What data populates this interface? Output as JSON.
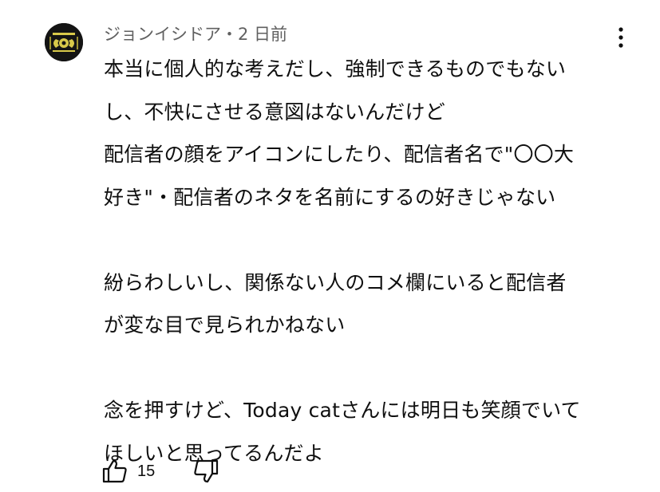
{
  "comment": {
    "author": "ジョンイシドア",
    "separator": "・",
    "time": "2 日前",
    "lines": [
      "本当に個人的な考えだし、強制できるものでもない",
      "し、不快にさせる意図はないんだけど",
      "配信者の顔をアイコンにしたり、配信者名で\"〇〇大",
      "好き\"・配信者のネタを名前にするの好きじゃない",
      "",
      "紛らわしいし、関係ない人のコメ欄にいると配信者",
      "が変な目で見られかねない",
      "",
      "念を押すけど、Today catさんには明日も笑顔でいて",
      "ほしいと思ってるんだよ"
    ],
    "like_count": "15"
  },
  "icons": {
    "avatar": "yellow-crest-avatar",
    "menu": "more-vertical-icon",
    "like": "thumb-up-icon",
    "dislike": "thumb-down-icon"
  },
  "colors": {
    "text": "#0f0f0f",
    "meta": "#606060",
    "avatar_bg": "#141414",
    "avatar_accent": "#d8c94a"
  }
}
